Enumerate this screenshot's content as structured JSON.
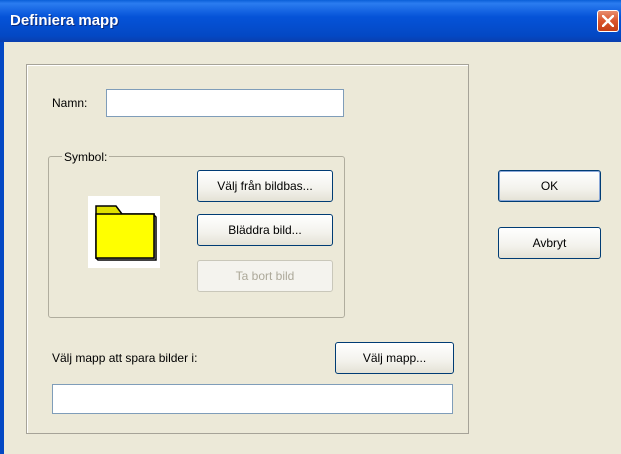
{
  "window": {
    "title": "Definiera mapp"
  },
  "form": {
    "name_label": "Namn:",
    "name_value": "",
    "symbol_group_label": "Symbol:",
    "symbol_icon": "folder-icon",
    "choose_from_library_label": "Välj från bildbas...",
    "browse_image_label": "Bläddra bild...",
    "remove_image_label": "Ta bort bild",
    "save_folder_label": "Välj mapp att spara bilder i:",
    "choose_folder_label": "Välj mapp...",
    "folder_path_value": ""
  },
  "actions": {
    "ok_label": "OK",
    "cancel_label": "Avbryt"
  },
  "colors": {
    "titlebar": "#0553d8",
    "dialog_background": "#ece9d8",
    "folder_fill": "#ffff00"
  }
}
